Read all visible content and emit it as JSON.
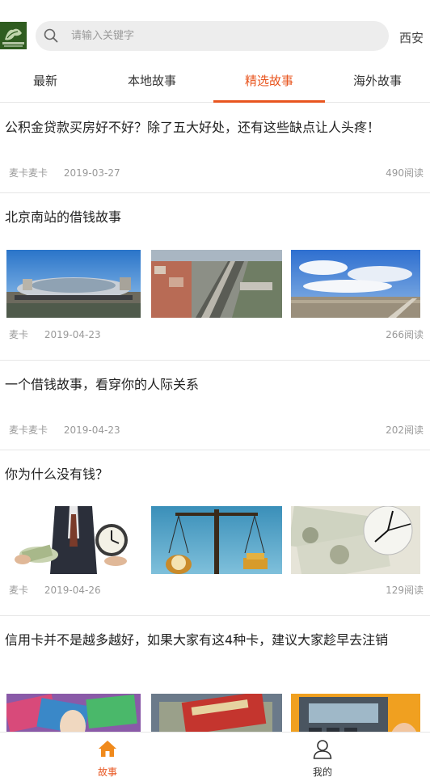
{
  "header": {
    "logo_alt": "logo",
    "search_placeholder": "请输入关键字",
    "city": "西安"
  },
  "tabs": [
    {
      "label": "最新",
      "active": false
    },
    {
      "label": "本地故事",
      "active": false
    },
    {
      "label": "精选故事",
      "active": true
    },
    {
      "label": "海外故事",
      "active": false
    }
  ],
  "articles": [
    {
      "title": "公积金贷款买房好不好？除了五大好处，还有这些缺点让人头疼！",
      "author": "麦卡麦卡",
      "date": "2019-03-27",
      "reads": "490阅读",
      "images": []
    },
    {
      "title": "北京南站的借钱故事",
      "author": "麦卡",
      "date": "2019-04-23",
      "reads": "266阅读",
      "images": [
        "railway-station-photo",
        "rail-tracks-photo",
        "blue-sky-field-photo"
      ]
    },
    {
      "title": "一个借钱故事，看穿你的人际关系",
      "author": "麦卡麦卡",
      "date": "2019-04-23",
      "reads": "202阅读",
      "images": []
    },
    {
      "title": "你为什么没有钱？",
      "author": "麦卡",
      "date": "2019-04-26",
      "reads": "129阅读",
      "images": [
        "money-and-clock-photo",
        "scale-with-clock-and-coins-photo",
        "dollar-bills-and-clock-photo"
      ]
    },
    {
      "title": "信用卡并不是越多越好，如果大家有这4种卡，建议大家趁早去注销",
      "author": "",
      "date": "",
      "reads": "",
      "images": [
        "credit-cards-photo",
        "cash-and-cards-photo",
        "card-terminal-photo"
      ]
    }
  ],
  "bottom_nav": [
    {
      "label": "故事",
      "icon": "home-icon",
      "active": true
    },
    {
      "label": "我的",
      "icon": "user-icon",
      "active": false
    }
  ],
  "colors": {
    "accent": "#e8551f",
    "divider": "#e6e6e6",
    "meta": "#999999"
  }
}
